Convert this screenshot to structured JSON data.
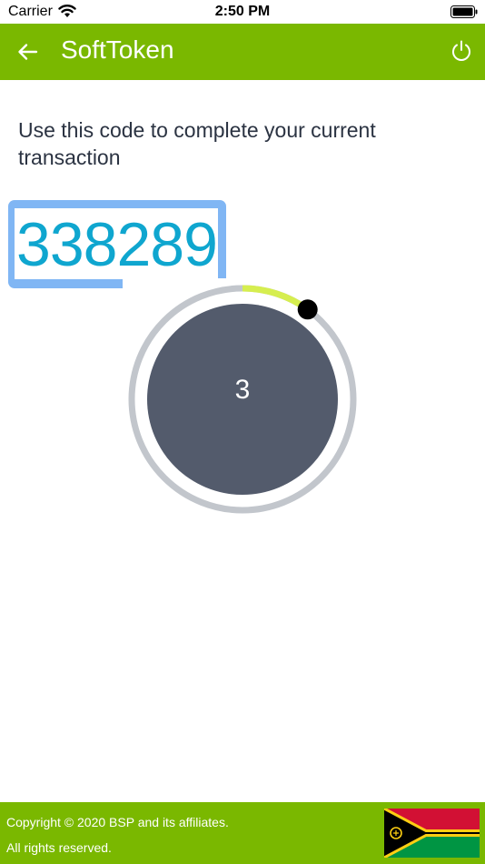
{
  "status_bar": {
    "carrier": "Carrier",
    "time": "2:50 PM"
  },
  "app_bar": {
    "title": "SoftToken",
    "back_icon": "arrow-left-icon",
    "power_icon": "power-icon",
    "color": "#7ab800"
  },
  "main": {
    "instruction": "Use this code to complete your current transaction",
    "otp_code": "338289",
    "otp_color": "#0fa6cf",
    "selection_color": "#80b6f4"
  },
  "timer": {
    "seconds_remaining": "3",
    "progress_fraction": 0.1,
    "progress_color": "#d6ee4f",
    "track_color": "#c2c6cc",
    "disc_color": "#535b6c"
  },
  "footer": {
    "copyright": "Copyright © 2020 BSP and its affiliates.",
    "rights": "All rights reserved.",
    "flag_icon": "vanuatu-flag-icon"
  }
}
